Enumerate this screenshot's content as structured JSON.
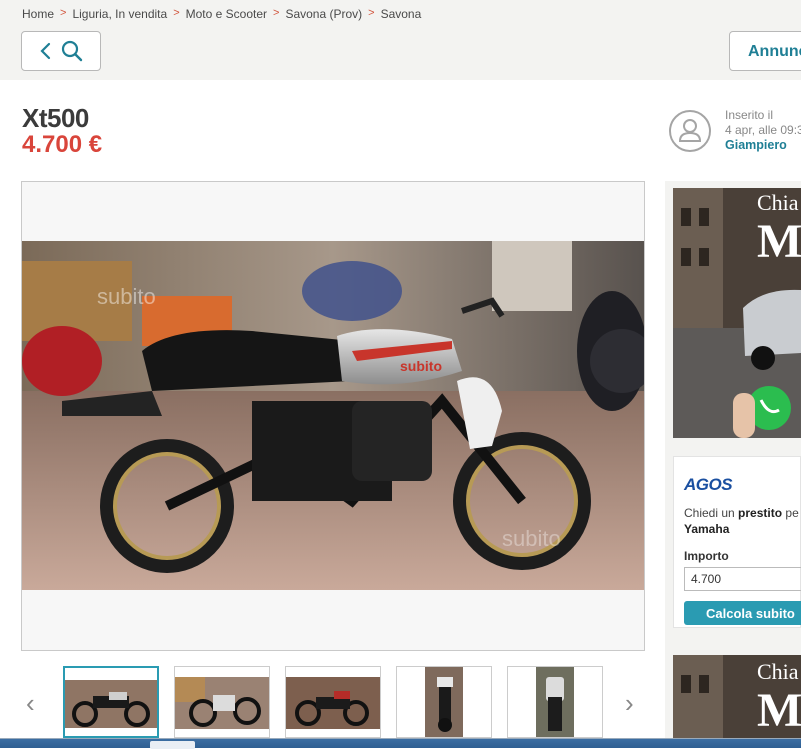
{
  "breadcrumb": [
    {
      "label": "Home"
    },
    {
      "label": "Liguria, In vendita"
    },
    {
      "label": "Moto e Scooter"
    },
    {
      "label": "Savona (Prov)"
    },
    {
      "label": "Savona"
    }
  ],
  "breadcrumb_separator": ">",
  "header": {
    "annunci_label": "Annunci"
  },
  "listing": {
    "title": "Xt500",
    "price": "4.700 €"
  },
  "seller": {
    "inserted_label": "Inserito il",
    "inserted_date": "4 apr, alle 09:3",
    "name": "Giampiero"
  },
  "gallery": {
    "watermark": "subito",
    "thumb_count": 5,
    "active_thumb": 1
  },
  "ads": {
    "top_banner_text": "Chia",
    "top_banner_big": "M",
    "bottom_banner_text": "Chia",
    "bottom_banner_big": "M"
  },
  "agos": {
    "logo": "AGOS",
    "line1_prefix": "Chiedi un ",
    "line1_bold": "prestito",
    "line1_suffix": " pe",
    "line2": "Yamaha",
    "amount_label": "Importo",
    "amount_value": "4.700",
    "button_label": "Calcola subito"
  },
  "colors": {
    "accent": "#1f7f95",
    "price": "#d9453b",
    "button": "#2a9bb2",
    "separator": "#d2553d"
  }
}
